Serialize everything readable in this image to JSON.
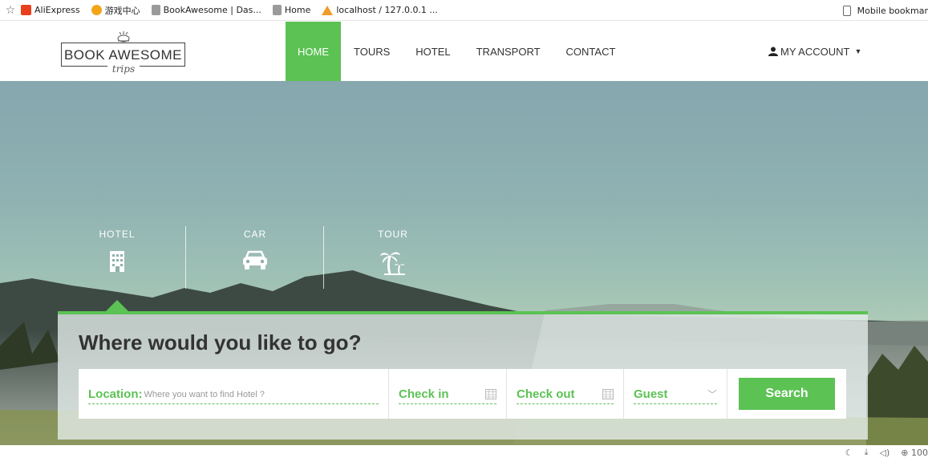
{
  "bookmarks": {
    "items": [
      {
        "label": "AliExpress",
        "icon": "aliexpress-icon"
      },
      {
        "label": "游戏中心",
        "icon": "game-center-icon"
      },
      {
        "label": "BookAwesome | Das...",
        "icon": "page-icon"
      },
      {
        "label": "Home",
        "icon": "page-icon"
      },
      {
        "label": "localhost / 127.0.0.1 ...",
        "icon": "phpmyadmin-icon"
      }
    ],
    "mobile_label": "Mobile bookmar"
  },
  "logo": {
    "main": "BOOK AWESOME",
    "sub": "trips"
  },
  "nav": {
    "items": [
      "HOME",
      "TOURS",
      "HOTEL",
      "TRANSPORT",
      "CONTACT"
    ],
    "active": "HOME",
    "account_label": "MY ACCOUNT"
  },
  "hero": {
    "tabs": [
      {
        "label": "HOTEL",
        "icon": "building-icon"
      },
      {
        "label": "CAR",
        "icon": "car-icon"
      },
      {
        "label": "TOUR",
        "icon": "palm-tree-icon"
      }
    ],
    "active_tab": "HOTEL"
  },
  "search": {
    "title": "Where would you like to go?",
    "location_label": "Location:",
    "location_placeholder": "Where you want to find Hotel ?",
    "checkin_label": "Check in",
    "checkout_label": "Check out",
    "guest_label": "Guest",
    "button_label": "Search"
  },
  "status": {
    "zoom": "100"
  },
  "colors": {
    "accent": "#5cc254",
    "text": "#333333",
    "white": "#ffffff"
  }
}
